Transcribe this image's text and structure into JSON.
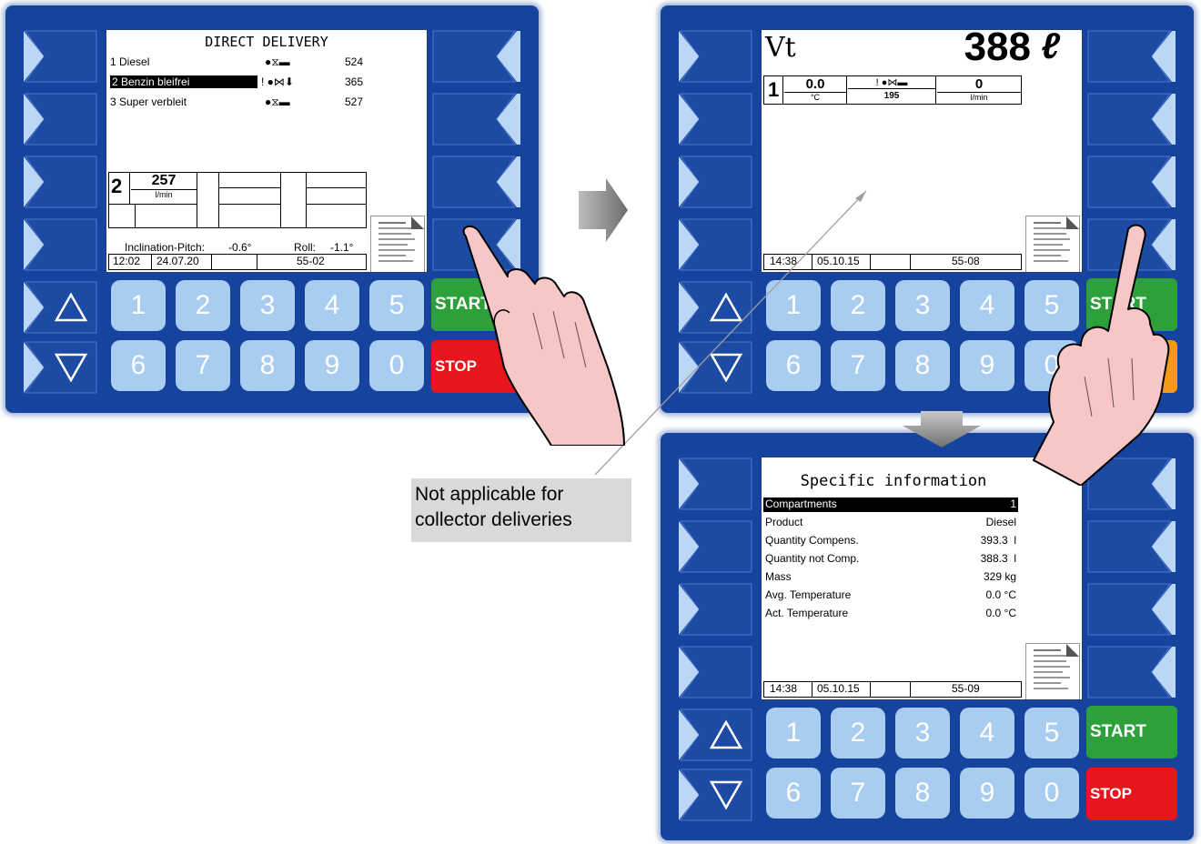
{
  "panel1": {
    "title": "DIRECT DELIVERY",
    "products": [
      {
        "label": "1 Diesel",
        "symbol": "●⧖▬",
        "value": "524"
      },
      {
        "label": "2 Benzin bleifrei",
        "symbol": "! ●⋈⬇",
        "value": "365"
      },
      {
        "label": "3 Super verbleit",
        "symbol": "●⧖▬",
        "value": "527"
      }
    ],
    "compartment": "2",
    "flow_value": "257",
    "flow_unit": "l/min",
    "inclination_label": "Inclination-Pitch:",
    "inclination_value": "-0.6°",
    "roll_label": "Roll:",
    "roll_value": "-1.1°",
    "time": "12:02",
    "date": "24.07.20",
    "code": "55-02"
  },
  "panel2": {
    "vt_label": "Vt",
    "volume": "388",
    "volume_unit": "ℓ",
    "compartment": "1",
    "temp_value": "0.0",
    "temp_unit": "°C",
    "status_symbol": "! ●⋈▬",
    "status_value": "195",
    "flow_value": "0",
    "flow_unit": "l/min",
    "time": "14:38",
    "date": "05.10.15",
    "code": "55-08"
  },
  "panel3": {
    "title": "Specific information",
    "rows": [
      {
        "label": "Compartments",
        "value": "1"
      },
      {
        "label": "Product",
        "value": "Diesel"
      },
      {
        "label": "Quantity Compens.",
        "value": "393.3  l"
      },
      {
        "label": "Quantity not Comp.",
        "value": "388.3  l"
      },
      {
        "label": "Mass",
        "value": "329 kg"
      },
      {
        "label": "Avg. Temperature",
        "value": "0.0 °C"
      },
      {
        "label": "Act. Temperature",
        "value": "0.0 °C"
      }
    ],
    "time": "14:38",
    "date": "05.10.15",
    "code": "55-09"
  },
  "keypad": {
    "row1": [
      "1",
      "2",
      "3",
      "4",
      "5"
    ],
    "row2": [
      "6",
      "7",
      "8",
      "9",
      "0"
    ],
    "start": "START",
    "stop": "STOP"
  },
  "callout": {
    "line1": "Not applicable for",
    "line2": "collector deliveries"
  },
  "icons": {
    "up": "triangle-up-icon",
    "down": "triangle-down-icon",
    "softkey": "chevron-softkey-icon",
    "document": "document-icon",
    "hand": "pointing-hand-icon",
    "arrow": "flow-arrow-icon"
  },
  "colors": {
    "panel_blue": "#16439e",
    "key_blue": "#a9cdf0",
    "start_green": "#2ea03a",
    "stop_red": "#e8141e",
    "orange": "#f39a1a"
  }
}
